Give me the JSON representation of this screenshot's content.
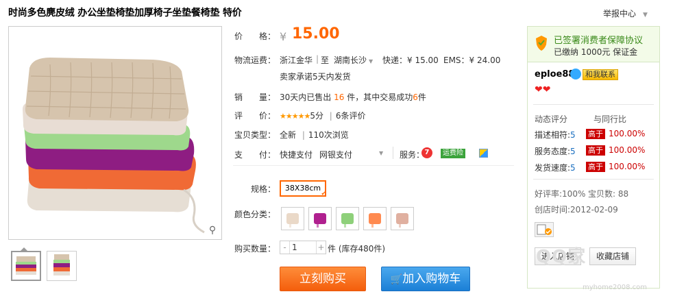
{
  "title": "时尚多色麂皮绒 办公坐垫椅垫加厚椅子坐垫餐椅垫 特价",
  "report": "举报中心",
  "price": {
    "label": "价　　格：",
    "currency": "¥",
    "value": "15.00"
  },
  "shipping": {
    "label": "物流运费：",
    "from": "浙江金华",
    "sep": "|",
    "to_prefix": "至",
    "to": "湖南长沙",
    "express": "快递：¥ 15.00",
    "ems": "EMS：¥ 24.00",
    "promise": "卖家承诺5天内发货"
  },
  "sales": {
    "label": "销　　量：",
    "prefix": "30天内已售出",
    "count": "16",
    "mid": "件，其中交易成功",
    "success": "6",
    "suffix": "件"
  },
  "review": {
    "label": "评　　价：",
    "stars": "★★★★★",
    "score": "5分",
    "sep": "|",
    "count": "6条评价"
  },
  "item_type": {
    "label": "宝贝类型：",
    "value": "全新",
    "sep": "|",
    "views": "110次浏览"
  },
  "payment": {
    "label": "支　　付：",
    "quick": "快捷支付",
    "bank": "网银支付",
    "service_label": "服务：",
    "insurance": "运费险"
  },
  "spec": {
    "label": "规格：",
    "option": "38X38cm"
  },
  "color_label": "颜色分类：",
  "colors": [
    "#ead9c8",
    "#b0208f",
    "#8ed07a",
    "#ff8a50",
    "#e0b0a0"
  ],
  "quantity": {
    "label": "购买数量：",
    "minus": "-",
    "value": "1",
    "plus": "+",
    "suffix": "件 (库存480件)"
  },
  "buttons": {
    "buy": "立刻购买",
    "cart": "加入购物车"
  },
  "seller": {
    "guarantee": "已签署消费者保障协议",
    "deposit": "已缴纳 1000元 保证金",
    "name": "eploe88",
    "contact": "和我联系",
    "hearts": "❤❤",
    "rating_header": "动态评分",
    "compare_header": "与同行比",
    "ratings": [
      {
        "label": "描述相符:",
        "score": "5",
        "tag": "高于",
        "pct": "100.00%"
      },
      {
        "label": "服务态度:",
        "score": "5",
        "tag": "高于",
        "pct": "100.00%"
      },
      {
        "label": "发货速度:",
        "score": "5",
        "tag": "高于",
        "pct": "100.00%"
      }
    ],
    "good_rate": "好评率:100%",
    "item_count": "宝贝数: 88",
    "created": "创店时间:2012-02-09",
    "enter": "进入店铺",
    "favorite": "收藏店铺"
  },
  "watermark": "QQ家",
  "watermark_url": "myhome2008.com"
}
